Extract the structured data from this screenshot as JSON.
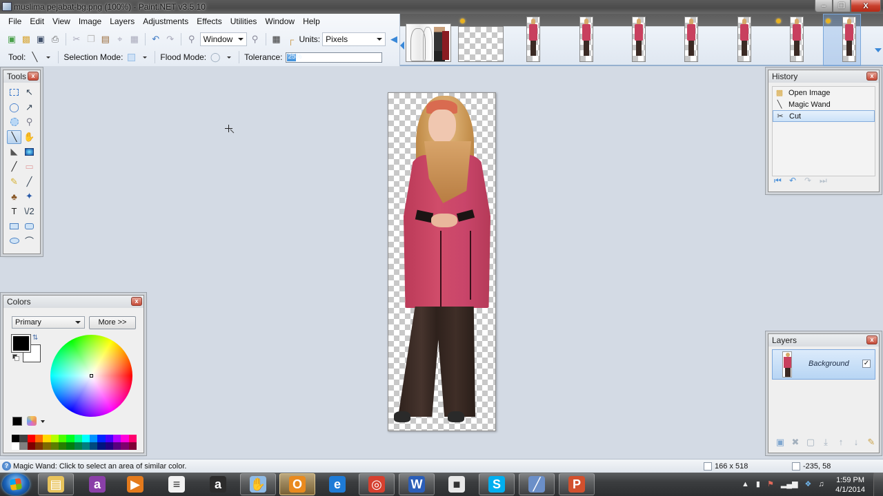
{
  "window": {
    "title": "muslima pejabat-bg.png (100%) - Paint.NET v3.5.10",
    "minimize_label": "–",
    "restore_label": "❐",
    "close_label": "X"
  },
  "menu": {
    "items": [
      "File",
      "Edit",
      "View",
      "Image",
      "Layers",
      "Adjustments",
      "Effects",
      "Utilities",
      "Window",
      "Help"
    ]
  },
  "toolbar": {
    "icons": [
      "new-icon",
      "open-icon",
      "save-icon",
      "print-icon",
      "cut-icon",
      "copy-icon",
      "paste-icon",
      "crop-icon",
      "deselect-icon",
      "undo-icon",
      "redo-icon",
      "zoom-out-icon",
      "zoom-in-icon",
      "grid-icon",
      "rulers-icon"
    ],
    "zoom_value": "Window",
    "units_label": "Units:",
    "units_value": "Pixels"
  },
  "tool_options": {
    "tool_label": "Tool:",
    "selection_mode_label": "Selection Mode:",
    "flood_mode_label": "Flood Mode:",
    "tolerance_label": "Tolerance:",
    "tolerance_value": "25%",
    "tolerance_percent": 25
  },
  "image_strip": {
    "thumbnails": [
      {
        "name": "avengers-sketch",
        "kind": "avengers"
      },
      {
        "name": "blank-transparent",
        "kind": "checker"
      },
      {
        "name": "muslima-1",
        "kind": "figure"
      },
      {
        "name": "muslima-2",
        "kind": "figure"
      },
      {
        "name": "muslima-3",
        "kind": "figure"
      },
      {
        "name": "muslima-4",
        "kind": "figure"
      },
      {
        "name": "muslima-5",
        "kind": "figure"
      },
      {
        "name": "muslima-6",
        "kind": "figure"
      },
      {
        "name": "muslima-7",
        "kind": "figure",
        "selected": true
      }
    ]
  },
  "tools_panel": {
    "title": "Tools",
    "close_label": "x",
    "tools": [
      {
        "name": "rectangle-select",
        "glyph": ""
      },
      {
        "name": "move-selected-pixels",
        "glyph": "↖"
      },
      {
        "name": "lasso-select",
        "glyph": "◯"
      },
      {
        "name": "move-selection",
        "glyph": "↗"
      },
      {
        "name": "ellipse-select",
        "glyph": ""
      },
      {
        "name": "zoom",
        "glyph": "⚲"
      },
      {
        "name": "magic-wand",
        "glyph": "╲",
        "active": true
      },
      {
        "name": "pan",
        "glyph": "✋"
      },
      {
        "name": "paint-bucket",
        "glyph": "◣"
      },
      {
        "name": "gradient",
        "glyph": ""
      },
      {
        "name": "paintbrush",
        "glyph": "╱"
      },
      {
        "name": "eraser",
        "glyph": "▭"
      },
      {
        "name": "pencil",
        "glyph": "✎"
      },
      {
        "name": "color-picker",
        "glyph": "╱"
      },
      {
        "name": "clone-stamp",
        "glyph": "♣"
      },
      {
        "name": "recolor",
        "glyph": "✦"
      },
      {
        "name": "text",
        "glyph": "T"
      },
      {
        "name": "line-curve",
        "glyph": "\\/2"
      },
      {
        "name": "rectangle",
        "glyph": ""
      },
      {
        "name": "rounded-rectangle",
        "glyph": ""
      },
      {
        "name": "ellipse",
        "glyph": ""
      },
      {
        "name": "freeform-shape",
        "glyph": "⌒"
      }
    ]
  },
  "colors_panel": {
    "title": "Colors",
    "close_label": "x",
    "mode_value": "Primary",
    "more_label": "More >>",
    "primary_color": "#000000",
    "secondary_color": "#ffffff",
    "palette_top": [
      "#000000",
      "#404040",
      "#ff0000",
      "#ff6a00",
      "#ffd800",
      "#b6ff00",
      "#4cff00",
      "#00ff21",
      "#00ff90",
      "#00ffff",
      "#0094ff",
      "#0026ff",
      "#4800ff",
      "#b200ff",
      "#ff00dc",
      "#ff006e"
    ],
    "palette_bottom": [
      "#ffffff",
      "#808080",
      "#7f0000",
      "#7f3300",
      "#7f6a00",
      "#5b7f00",
      "#267f00",
      "#007f0e",
      "#007f46",
      "#007f7f",
      "#004a7f",
      "#00137f",
      "#21007f",
      "#57007f",
      "#7f006e",
      "#7f0037"
    ]
  },
  "history_panel": {
    "title": "History",
    "close_label": "x",
    "items": [
      {
        "label": "Open Image",
        "icon": "open-folder-icon",
        "glyph": "📂"
      },
      {
        "label": "Magic Wand",
        "icon": "magic-wand-icon",
        "glyph": "╲"
      },
      {
        "label": "Cut",
        "icon": "scissors-icon",
        "glyph": "✂",
        "selected": true
      }
    ],
    "nav": [
      {
        "name": "rewind-icon",
        "glyph": "⏮",
        "enabled": true
      },
      {
        "name": "undo-icon",
        "glyph": "↶",
        "enabled": true
      },
      {
        "name": "redo-icon",
        "glyph": "↷",
        "enabled": false
      },
      {
        "name": "fast-forward-icon",
        "glyph": "⏭",
        "enabled": false
      }
    ]
  },
  "layers_panel": {
    "title": "Layers",
    "close_label": "x",
    "layers": [
      {
        "name": "Background",
        "visible": true,
        "check_glyph": "✓"
      }
    ],
    "buttons": [
      {
        "name": "add-layer-icon",
        "glyph": "▣"
      },
      {
        "name": "delete-layer-icon",
        "glyph": "✖"
      },
      {
        "name": "duplicate-layer-icon",
        "glyph": "▢"
      },
      {
        "name": "merge-layer-down-icon",
        "glyph": "⤓"
      },
      {
        "name": "move-layer-up-icon",
        "glyph": "↑"
      },
      {
        "name": "move-layer-down-icon",
        "glyph": "↓"
      },
      {
        "name": "layer-properties-icon",
        "glyph": "✎"
      }
    ]
  },
  "status": {
    "help_glyph": "?",
    "message": "Magic Wand: Click to select an area of similar color.",
    "image_size": "166 x 518",
    "cursor_position": "-235, 58"
  },
  "taskbar": {
    "apps": [
      {
        "name": "windows-explorer",
        "glyph": "▤",
        "color": "#e8c35c",
        "state": "running"
      },
      {
        "name": "app-a-purple",
        "glyph": "a",
        "color": "#8a3fa8",
        "state": ""
      },
      {
        "name": "media-player",
        "glyph": "▶",
        "color": "#e47a1c",
        "state": ""
      },
      {
        "name": "document-viewer",
        "glyph": "≡",
        "color": "#f2f2f2",
        "state": ""
      },
      {
        "name": "app-a-green",
        "glyph": "a",
        "color": "#2c2c2c",
        "state": ""
      },
      {
        "name": "hand-app",
        "glyph": "✋",
        "color": "#8fbbe6",
        "state": "running"
      },
      {
        "name": "outlook",
        "glyph": "O",
        "color": "#e98a1e",
        "state": "active"
      },
      {
        "name": "internet-explorer",
        "glyph": "e",
        "color": "#1e7bd6",
        "state": ""
      },
      {
        "name": "chrome",
        "glyph": "◎",
        "color": "#d6402f",
        "state": "running"
      },
      {
        "name": "word",
        "glyph": "W",
        "color": "#2b5eb8",
        "state": "running"
      },
      {
        "name": "camera-app",
        "glyph": "■",
        "color": "#e8e8e8",
        "state": ""
      },
      {
        "name": "skype",
        "glyph": "S",
        "color": "#00aff0",
        "state": "running"
      },
      {
        "name": "paint-net",
        "glyph": "╱",
        "color": "#6b8fc8",
        "state": "running"
      },
      {
        "name": "powerpoint",
        "glyph": "P",
        "color": "#d2502d",
        "state": "running"
      }
    ],
    "tray": [
      {
        "name": "show-hidden-icons",
        "glyph": "▲"
      },
      {
        "name": "power-icon",
        "glyph": "▮"
      },
      {
        "name": "action-center-icon",
        "glyph": "⚑"
      },
      {
        "name": "network-signal-icon",
        "glyph": "▂▄▆"
      },
      {
        "name": "dropbox-icon",
        "glyph": "❖"
      },
      {
        "name": "volume-icon",
        "glyph": "♫"
      }
    ],
    "time": "1:59 PM",
    "date": "4/1/2014"
  }
}
